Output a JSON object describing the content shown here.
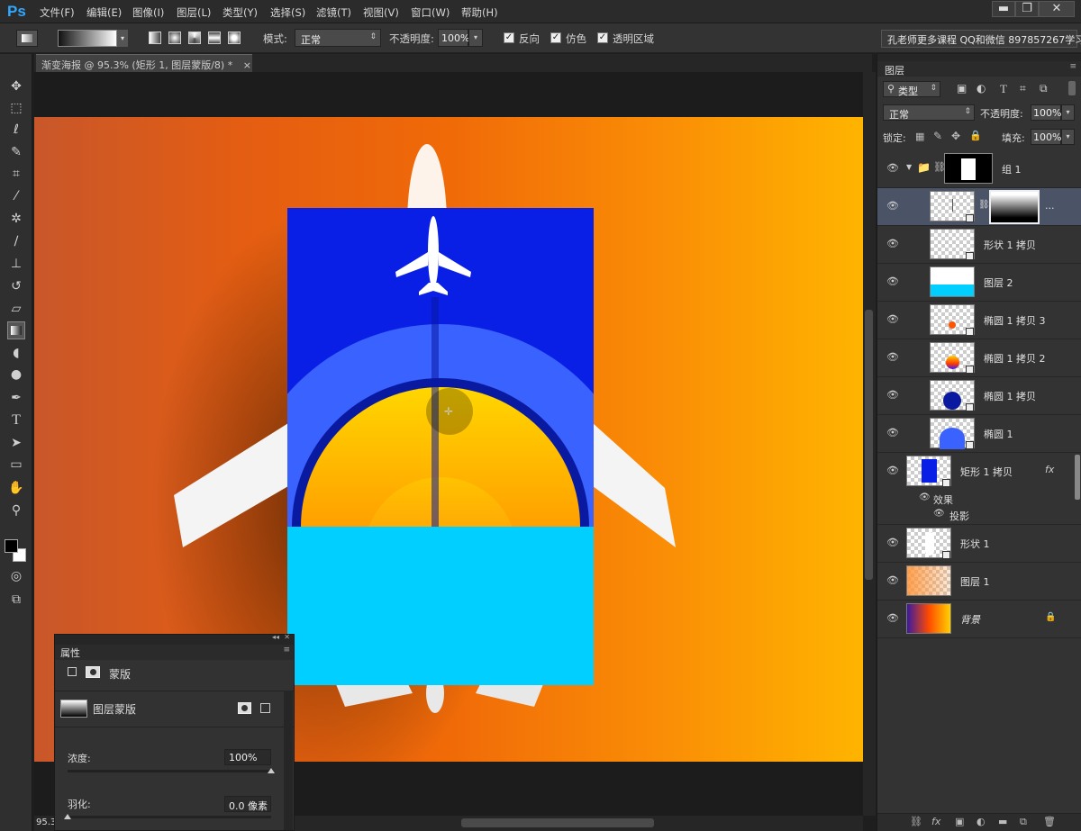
{
  "app": {
    "logo": "Ps"
  },
  "menu": [
    "文件(F)",
    "编辑(E)",
    "图像(I)",
    "图层(L)",
    "类型(Y)",
    "选择(S)",
    "滤镜(T)",
    "视图(V)",
    "窗口(W)",
    "帮助(H)"
  ],
  "window_controls": {
    "minimize": "▬",
    "restore": "❐",
    "close": "✕"
  },
  "options": {
    "mode_label": "模式:",
    "mode_value": "正常",
    "opacity_label": "不透明度:",
    "opacity_value": "100%",
    "reverse": "反向",
    "dither": "仿色",
    "transparency": "透明区域"
  },
  "hint_text": "孔老师更多课程 QQ和微信 897857267学习",
  "document": {
    "tab_title": "渐变海报 @ 95.3% (矩形 1, 图层蒙版/8) *",
    "tab_close": "×",
    "zoom": "95.3"
  },
  "properties": {
    "title": "属性",
    "mask_label": "蒙版",
    "layer_mask": "图层蒙版",
    "density_label": "浓度:",
    "density_value": "100%",
    "feather_label": "羽化:",
    "feather_value": "0.0 像素"
  },
  "layers_panel": {
    "title": "图层",
    "filter_kind": "类型",
    "blend_mode": "正常",
    "opacity_label": "不透明度:",
    "opacity_value": "100%",
    "lock_label": "锁定:",
    "fill_label": "填充:",
    "fill_value": "100%",
    "effects_label": "效果",
    "shadow_label": "投影",
    "fx": "fx",
    "more": "...",
    "layers": [
      "组 1",
      "形状 1 拷贝",
      "图层 2",
      "椭圆 1 拷贝 3",
      "椭圆 1 拷贝 2",
      "椭圆 1 拷贝",
      "椭圆 1",
      "矩形 1 拷贝",
      "形状 1",
      "图层 1",
      "背景"
    ]
  },
  "colors": {
    "accent": "#31a8ff",
    "poster_blue": "#0a1fe6",
    "poster_cyan": "#00cfff",
    "selected_layer": "#4b5467"
  }
}
